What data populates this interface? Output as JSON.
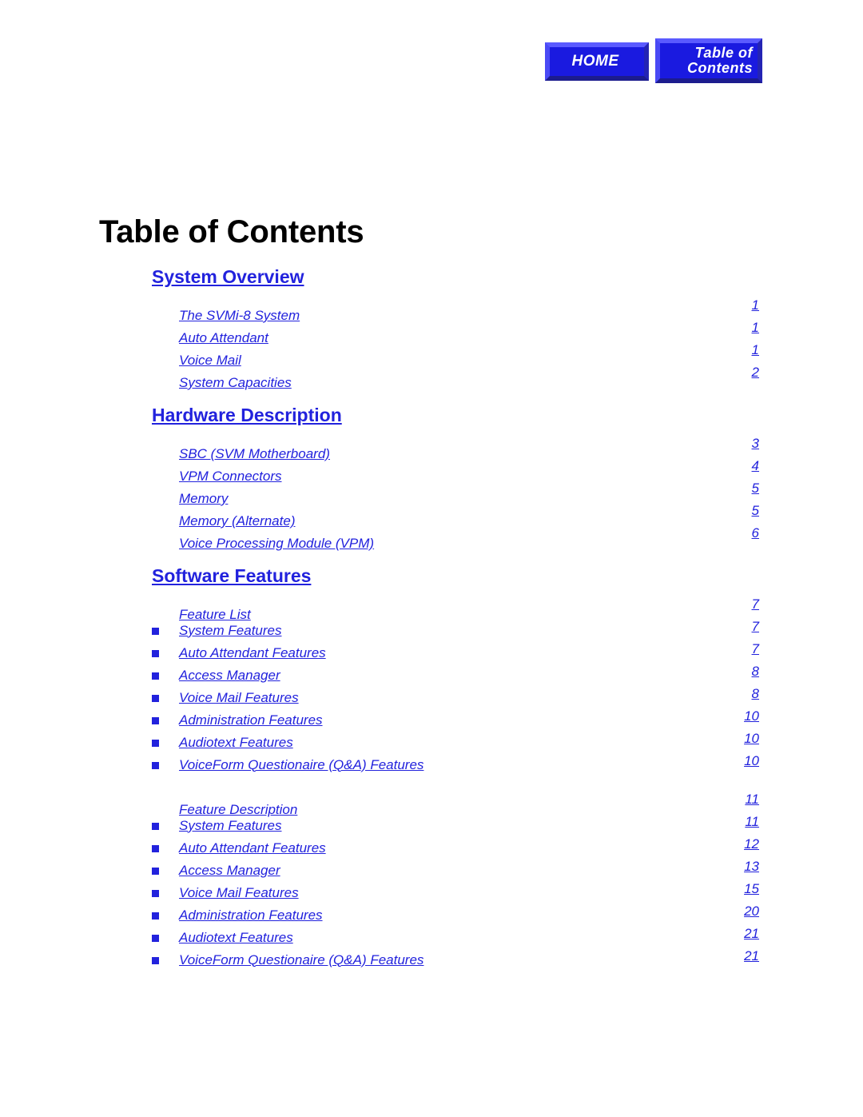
{
  "nav": {
    "home_label": "HOME",
    "toc_label_line1": "Table of",
    "toc_label_line2": "Contents"
  },
  "page_title": "Table of Contents",
  "colors": {
    "link_blue": "#2222dd",
    "button_blue": "#1a1ae0",
    "title_black": "#000000"
  },
  "sections": [
    {
      "heading": "System Overview",
      "groups": [
        {
          "rows": [
            {
              "label": "The SVMi-8 System",
              "page": "1",
              "bullet": false
            },
            {
              "label": "Auto Attendant",
              "page": "1",
              "bullet": false
            },
            {
              "label": "Voice Mail",
              "page": "1",
              "bullet": false
            },
            {
              "label": "System Capacities",
              "page": "2",
              "bullet": false
            }
          ]
        }
      ]
    },
    {
      "heading": "Hardware Description",
      "groups": [
        {
          "rows": [
            {
              "label": "SBC (SVM Motherboard)",
              "page": "3",
              "bullet": false
            },
            {
              "label": "VPM Connectors",
              "page": "4",
              "bullet": false
            },
            {
              "label": "Memory",
              "page": "5",
              "bullet": false
            },
            {
              "label": "Memory (Alternate)",
              "page": "5",
              "bullet": false
            },
            {
              "label": "Voice Processing Module (VPM)",
              "page": "6",
              "bullet": false
            }
          ]
        }
      ]
    },
    {
      "heading": "Software Features",
      "groups": [
        {
          "rows": [
            {
              "label": "Feature List",
              "page": "7",
              "bullet": false
            },
            {
              "label": "System Features ",
              "page": "7",
              "bullet": true
            },
            {
              "label": "Auto Attendant Features",
              "page": "7",
              "bullet": true
            },
            {
              "label": "Access Manager",
              "page": "8",
              "bullet": true
            },
            {
              "label": "Voice Mail Features",
              "page": "8",
              "bullet": true
            },
            {
              "label": "Administration Features",
              "page": "10",
              "bullet": true
            },
            {
              "label": "Audiotext Features",
              "page": "10",
              "bullet": true
            },
            {
              "label": "VoiceForm Questionaire (Q&A) Features",
              "page": "10",
              "bullet": true
            }
          ]
        },
        {
          "rows": [
            {
              "label": "Feature Description",
              "page": "11",
              "bullet": false
            },
            {
              "label": "System Features ",
              "page": "11",
              "bullet": true
            },
            {
              "label": "Auto Attendant Features",
              "page": "12",
              "bullet": true
            },
            {
              "label": "Access Manager",
              "page": "13",
              "bullet": true
            },
            {
              "label": "Voice Mail Features",
              "page": "15",
              "bullet": true
            },
            {
              "label": "Administration Features",
              "page": "20",
              "bullet": true
            },
            {
              "label": "Audiotext Features",
              "page": "21",
              "bullet": true
            },
            {
              "label": "VoiceForm Questionaire (Q&A) Features",
              "page": "21",
              "bullet": true
            }
          ]
        }
      ]
    }
  ]
}
